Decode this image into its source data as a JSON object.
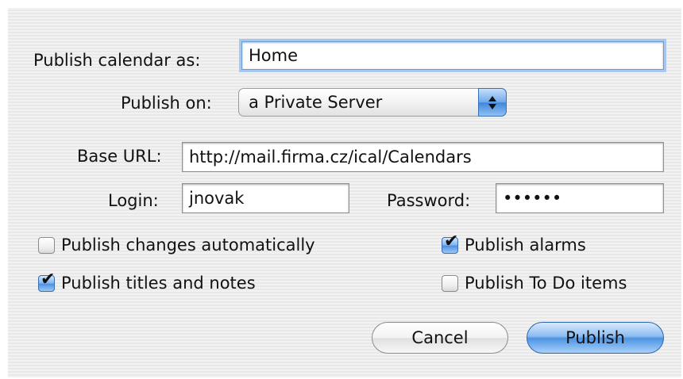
{
  "form": {
    "publish_as_label": "Publish calendar as:",
    "publish_as_value": "Home",
    "publish_on_label": "Publish on:",
    "publish_on_value": "a Private Server",
    "base_url_label": "Base URL:",
    "base_url_value": "http://mail.firma.cz/ical/Calendars",
    "login_label": "Login:",
    "login_value": "jnovak",
    "password_label": "Password:",
    "password_value": "••••••"
  },
  "options": {
    "changes_auto": {
      "label": "Publish changes automatically",
      "checked": false
    },
    "titles_notes": {
      "label": "Publish titles and notes",
      "checked": true
    },
    "alarms": {
      "label": "Publish alarms",
      "checked": true
    },
    "todo_items": {
      "label": "Publish To Do items",
      "checked": false
    }
  },
  "buttons": {
    "cancel_label": "Cancel",
    "publish_label": "Publish"
  },
  "colors": {
    "focus_ring": "#a6c8ef",
    "aqua_blue": "#4d94e3"
  },
  "icons": {
    "popup_arrows": "updown-arrows-icon",
    "check": "checkmark-icon"
  }
}
